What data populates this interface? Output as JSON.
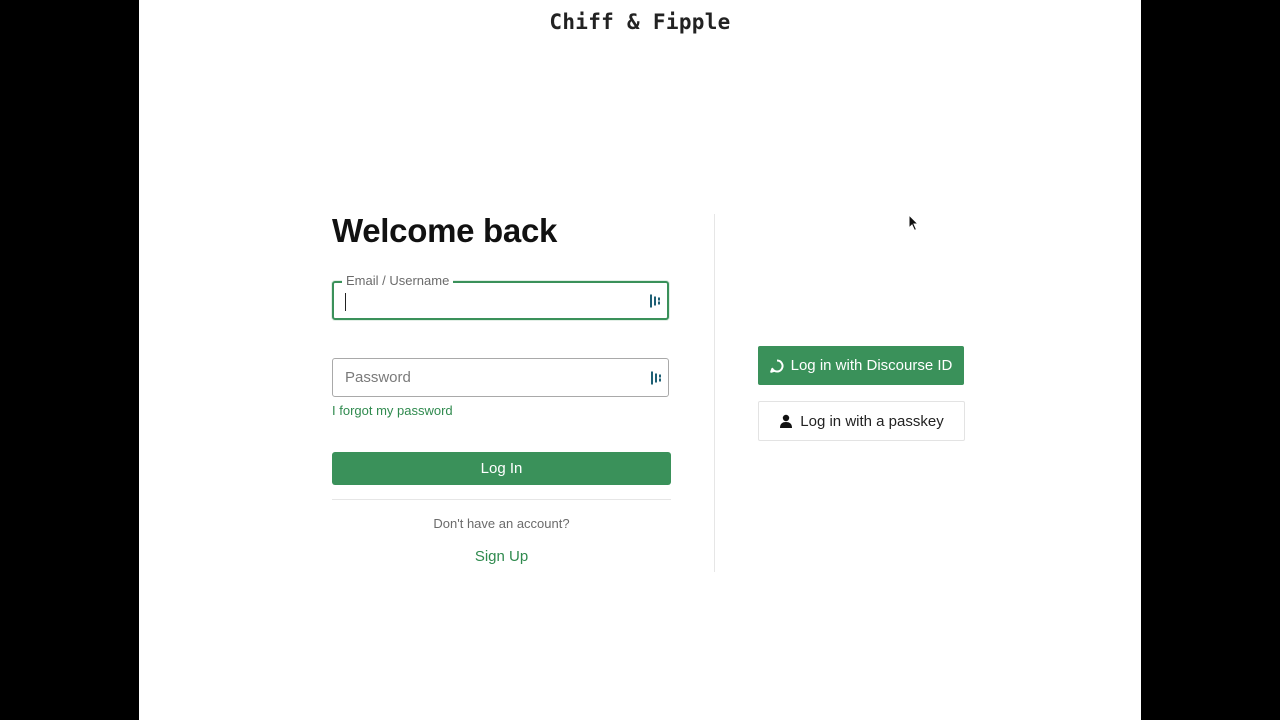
{
  "header": {
    "site_title": "Chiff & Fipple"
  },
  "login": {
    "heading": "Welcome back",
    "email_label": "Email / Username",
    "email_value": "",
    "password_placeholder": "Password",
    "password_value": "",
    "forgot_link": "I forgot my password",
    "login_button": "Log In",
    "no_account_text": "Don't have an account?",
    "signup_link": "Sign Up"
  },
  "external": {
    "discourse_button": "Log in with Discourse ID",
    "discourse_icon": "chat-bubble-icon",
    "passkey_button": "Log in with a passkey",
    "passkey_icon": "user-icon"
  },
  "colors": {
    "accent": "#3a915a",
    "link": "#2f8a4e",
    "page_background": "#ffffff",
    "outer_background": "#000000"
  }
}
